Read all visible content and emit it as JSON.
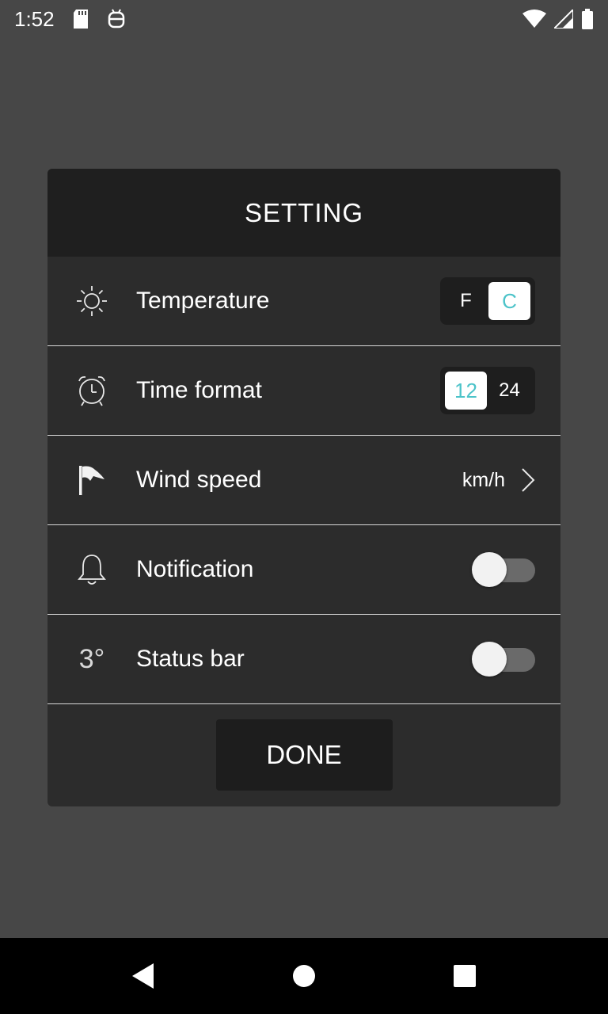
{
  "status_bar": {
    "time": "1:52",
    "icons": [
      "sd-card-icon",
      "android-icon",
      "wifi-icon",
      "signal-icon",
      "battery-icon"
    ]
  },
  "dialog": {
    "title": "SETTING",
    "rows": [
      {
        "icon": "sun-icon",
        "label": "Temperature",
        "control": "segmented",
        "options": [
          "F",
          "C"
        ],
        "selected": "C"
      },
      {
        "icon": "alarm-clock-icon",
        "label": "Time format",
        "control": "segmented",
        "options": [
          "12",
          "24"
        ],
        "selected": "12"
      },
      {
        "icon": "wind-flag-icon",
        "label": "Wind speed",
        "control": "value",
        "value": "km/h"
      },
      {
        "icon": "bell-icon",
        "label": "Notification",
        "control": "toggle",
        "on": false
      },
      {
        "icon": "status-bar-temp-icon",
        "icon_text": "3°",
        "label": "Status bar",
        "control": "toggle",
        "on": false
      }
    ],
    "done_label": "DONE"
  },
  "colors": {
    "accent": "#4cc3c9",
    "background": "#474747",
    "dialog_bg": "#2c2c2c",
    "header_bg": "#1f1f1f"
  }
}
